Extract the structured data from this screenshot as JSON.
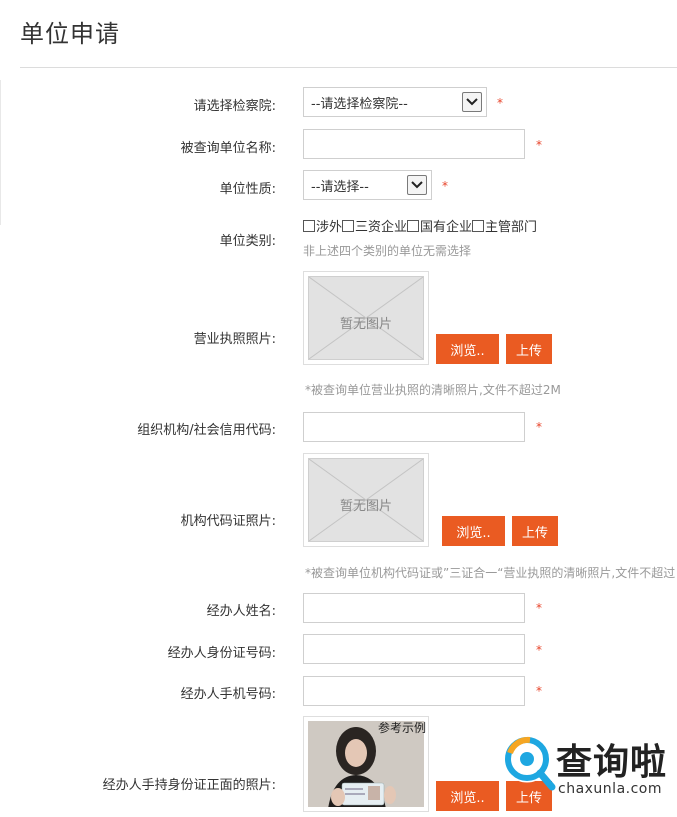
{
  "page": {
    "title": "单位申请"
  },
  "form": {
    "procuratorate": {
      "label": "请选择检察院:",
      "value": "--请选择检察院--",
      "required": "*"
    },
    "unit_name": {
      "label": "被查询单位名称:",
      "value": "",
      "required": "*"
    },
    "unit_nature": {
      "label": "单位性质:",
      "value": "--请选择--",
      "required": "*"
    },
    "unit_category": {
      "label": "单位类别:",
      "options": [
        "涉外",
        "三资企业",
        "国有企业",
        "主管部门"
      ],
      "hint": "非上述四个类别的单位无需选择"
    },
    "business_license": {
      "label": "营业执照照片:",
      "placeholder": "暂无图片",
      "browse": "浏览..",
      "upload": "上传",
      "hint": "*被查询单位营业执照的清晰照片,文件不超过2M"
    },
    "credit_code": {
      "label": "组织机构/社会信用代码:",
      "value": "",
      "required": "*"
    },
    "org_code_photo": {
      "label": "机构代码证照片:",
      "placeholder": "暂无图片",
      "browse": "浏览..",
      "upload": "上传",
      "hint": "*被查询单位机构代码证或”三证合一“营业执照的清晰照片,文件不超过"
    },
    "agent_name": {
      "label": "经办人姓名:",
      "value": "",
      "required": "*"
    },
    "agent_id": {
      "label": "经办人身份证号码:",
      "value": "",
      "required": "*"
    },
    "agent_phone": {
      "label": "经办人手机号码:",
      "value": "",
      "required": "*"
    },
    "agent_id_photo": {
      "label": "经办人手持身份证正面的照片:",
      "sample_label": "参考示例",
      "browse": "浏览..",
      "upload": "上传"
    }
  },
  "watermark": {
    "text": "查询啦",
    "sub": "chaxunla.com",
    "icon": "magnifier-logo-icon"
  },
  "colors": {
    "accent": "#ea5b22",
    "required": "#e8442a",
    "border": "#cfcfcf"
  }
}
